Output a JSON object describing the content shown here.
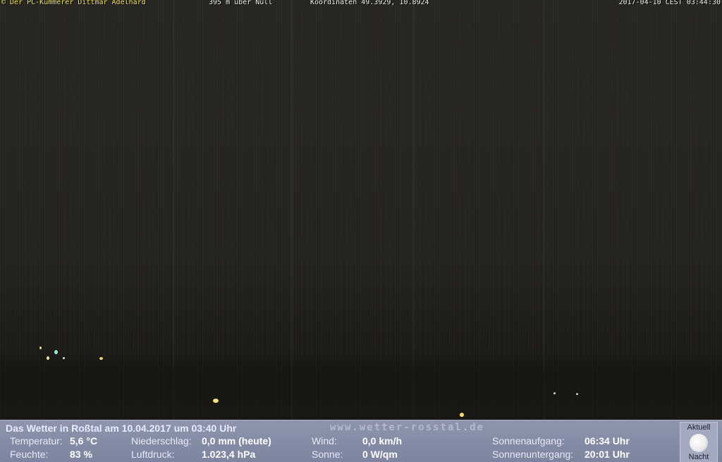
{
  "overlay": {
    "owner": "© Der PC-Kümmerer Dittmar Adelhard",
    "altitude": "395 m über Null",
    "coordinates": "Koordinaten 49.3929, 10.8924",
    "timestamp": "2017-04-10 CEST 03:44:30"
  },
  "weather": {
    "title": "Das Wetter in Roßtal am 10.04.2017 um 03:40 Uhr",
    "site": "www.wetter-rosstal.de",
    "temperature_label": "Temperatur:",
    "temperature_value": "5,6 °C",
    "humidity_label": "Feuchte:",
    "humidity_value": "83 %",
    "precip_label": "Niederschlag:",
    "precip_value": "0,0 mm (heute)",
    "pressure_label": "Luftdruck:",
    "pressure_value": "1.023,4 hPa",
    "wind_label": "Wind:",
    "wind_value": "0,0 km/h",
    "sun_label": "Sonne:",
    "sun_value": "0 W/qm",
    "sunrise_label": "Sonnenaufgang:",
    "sunrise_value": "06:34 Uhr",
    "sunset_label": "Sonnenuntergang:",
    "sunset_value": "20:01 Uhr",
    "moon_caption": "Aktuell",
    "moon_state": "Nacht"
  }
}
